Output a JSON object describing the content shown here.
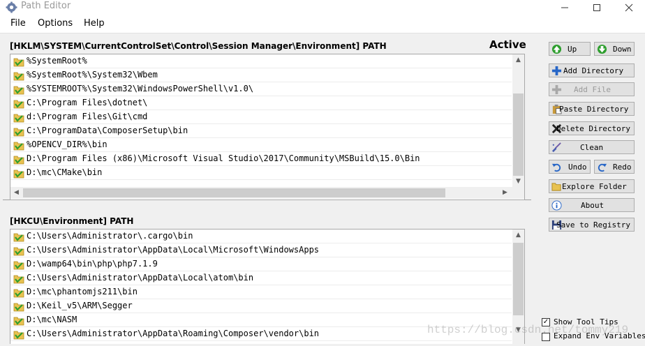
{
  "window": {
    "title": "Path Editor"
  },
  "menu": [
    "File",
    "Options",
    "Help"
  ],
  "system_group": {
    "title": "[HKLM\\SYSTEM\\CurrentControlSet\\Control\\Session Manager\\Environment] PATH",
    "status": "Active",
    "items": [
      "%SystemRoot%",
      "%SystemRoot%\\System32\\Wbem",
      "%SYSTEMROOT%\\System32\\WindowsPowerShell\\v1.0\\",
      "C:\\Program Files\\dotnet\\",
      "d:\\Program Files\\Git\\cmd",
      "C:\\ProgramData\\ComposerSetup\\bin",
      "%OPENCV_DIR%\\bin",
      "D:\\Program Files (x86)\\Microsoft Visual Studio\\2017\\Community\\MSBuild\\15.0\\Bin",
      "D:\\mc\\CMake\\bin"
    ]
  },
  "user_group": {
    "title": "[HKCU\\Environment] PATH",
    "items": [
      "C:\\Users\\Administrator\\.cargo\\bin",
      "C:\\Users\\Administrator\\AppData\\Local\\Microsoft\\WindowsApps",
      "D:\\wamp64\\bin\\php\\php7.1.9",
      "C:\\Users\\Administrator\\AppData\\Local\\atom\\bin",
      "D:\\mc\\phantomjs211\\bin",
      "D:\\Keil_v5\\ARM\\Segger",
      "D:\\mc\\NASM",
      "C:\\Users\\Administrator\\AppData\\Roaming\\Composer\\vendor\\bin"
    ]
  },
  "buttons": {
    "up": "Up",
    "down": "Down",
    "add_directory": "Add Directory",
    "add_file": "Add File",
    "paste_directory": "Paste Directory",
    "delete_directory": "Delete Directory",
    "clean": "Clean",
    "undo": "Undo",
    "redo": "Redo",
    "explore_folder": "Explore Folder",
    "about": "About",
    "save_to_registry": "Save to Registry"
  },
  "options": {
    "show_tool_tips": {
      "label": "Show Tool Tips",
      "checked": true
    },
    "expand_env_variables": {
      "label": "Expand Env Variables",
      "checked": false
    }
  },
  "watermark": "https://blog.csdn.net/tommy219",
  "icons": {
    "folder_check": "folder-check-icon",
    "up": "green-up-arrow-icon",
    "down": "green-down-arrow-icon",
    "add": "blue-plus-icon",
    "paste": "paste-icon",
    "delete": "delete-x-icon",
    "clean": "broom-icon",
    "undo": "undo-icon",
    "redo": "redo-icon",
    "explore": "folder-open-icon",
    "about": "info-icon",
    "save": "floppy-disk-icon"
  },
  "colors": {
    "accent_green": "#2e9e2e",
    "accent_blue": "#2766c7",
    "folder": "#e8c250"
  }
}
